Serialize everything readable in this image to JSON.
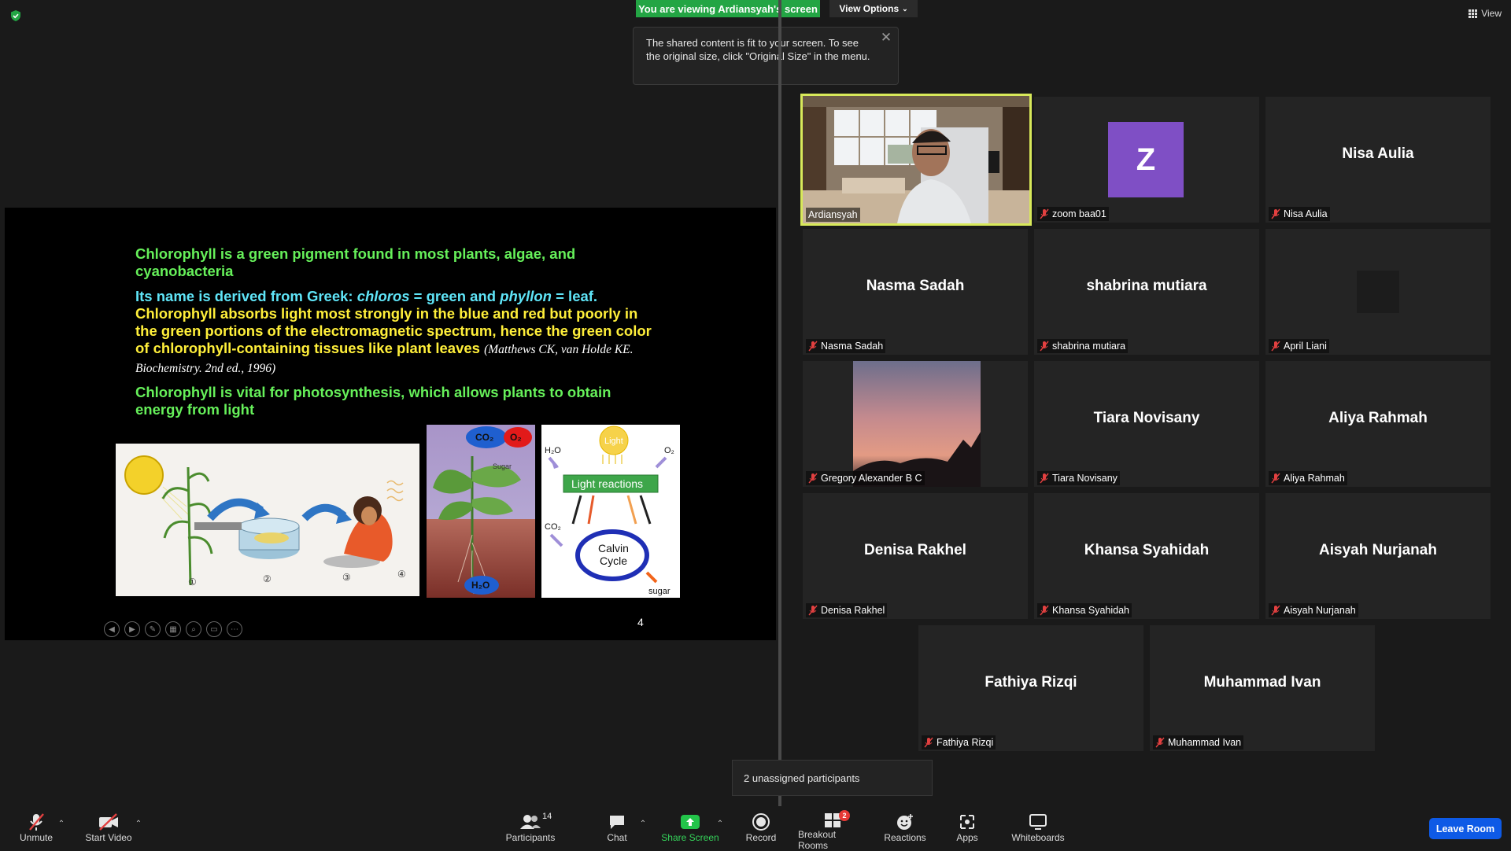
{
  "banner": {
    "viewing": "You are viewing Ardiansyah's screen",
    "view_options": "View Options"
  },
  "tooltip": {
    "text": "The shared content is fit to your screen. To see the original size, click \"Original Size\" in the menu."
  },
  "top_right": {
    "view_label": "View"
  },
  "slide": {
    "para1": "Chlorophyll is a green pigment found in most plants, algae, and cyanobacteria",
    "para2_prefix": "Its name is derived from Greek: ",
    "para2_chloros": "chloros",
    "para2_mid": " = green and ",
    "para2_phyllon": "phyllon",
    "para2_suffix": " = leaf.",
    "para2_yellow": "Chlorophyll absorbs light most strongly in the blue and red but poorly in the green portions of the electromagnetic spectrum, hence the green color of chlorophyll-containing tissues like plant leaves",
    "citation": "(Matthews CK, van Holde KE. Biochemistry. 2nd ed., 1996)",
    "para3": "Chlorophyll is vital for photosynthesis, which allows plants to obtain energy from light",
    "page_number": "4",
    "diagram": {
      "light": "Light",
      "h2o": "H₂O",
      "o2": "O₂",
      "co2": "CO₂",
      "light_reactions": "Light reactions",
      "calvin_cycle_1": "Calvin",
      "calvin_cycle_2": "Cycle",
      "sugar": "sugar",
      "plant_co2": "CO₂",
      "plant_o2": "O₂",
      "plant_sugar": "Sugar",
      "plant_h2o": "H₂O"
    },
    "steps": [
      "①",
      "②",
      "③",
      "④"
    ]
  },
  "participants": [
    {
      "name": "Ardiansyah",
      "video": true
    },
    {
      "name": "zoom baa01",
      "avatar_letter": "Z"
    },
    {
      "name": "Nisa Aulia"
    },
    {
      "name": "Nasma Sadah"
    },
    {
      "name": "shabrina mutiara"
    },
    {
      "name": "April Liani"
    },
    {
      "name": "Gregory Alexander B C"
    },
    {
      "name": "Tiara Novisany"
    },
    {
      "name": "Aliya Rahmah"
    },
    {
      "name": "Denisa Rakhel"
    },
    {
      "name": "Khansa Syahidah"
    },
    {
      "name": "Aisyah Nurjanah"
    },
    {
      "name": "Fathiya Rizqi"
    },
    {
      "name": "Muhammad Ivan"
    }
  ],
  "unassigned": "2 unassigned participants",
  "toolbar": {
    "unmute": "Unmute",
    "start_video": "Start Video",
    "participants": "Participants",
    "participants_count": "14",
    "chat": "Chat",
    "share_screen": "Share Screen",
    "record": "Record",
    "breakout_rooms": "Breakout Rooms",
    "breakout_badge": "2",
    "reactions": "Reactions",
    "apps": "Apps",
    "whiteboards": "Whiteboards",
    "leave_room": "Leave Room"
  },
  "colors": {
    "share_green": "#23a544",
    "leave_blue": "#0e5ae6",
    "active_speaker": "#d8e95a",
    "avatar_purple": "#7f4fc5"
  }
}
